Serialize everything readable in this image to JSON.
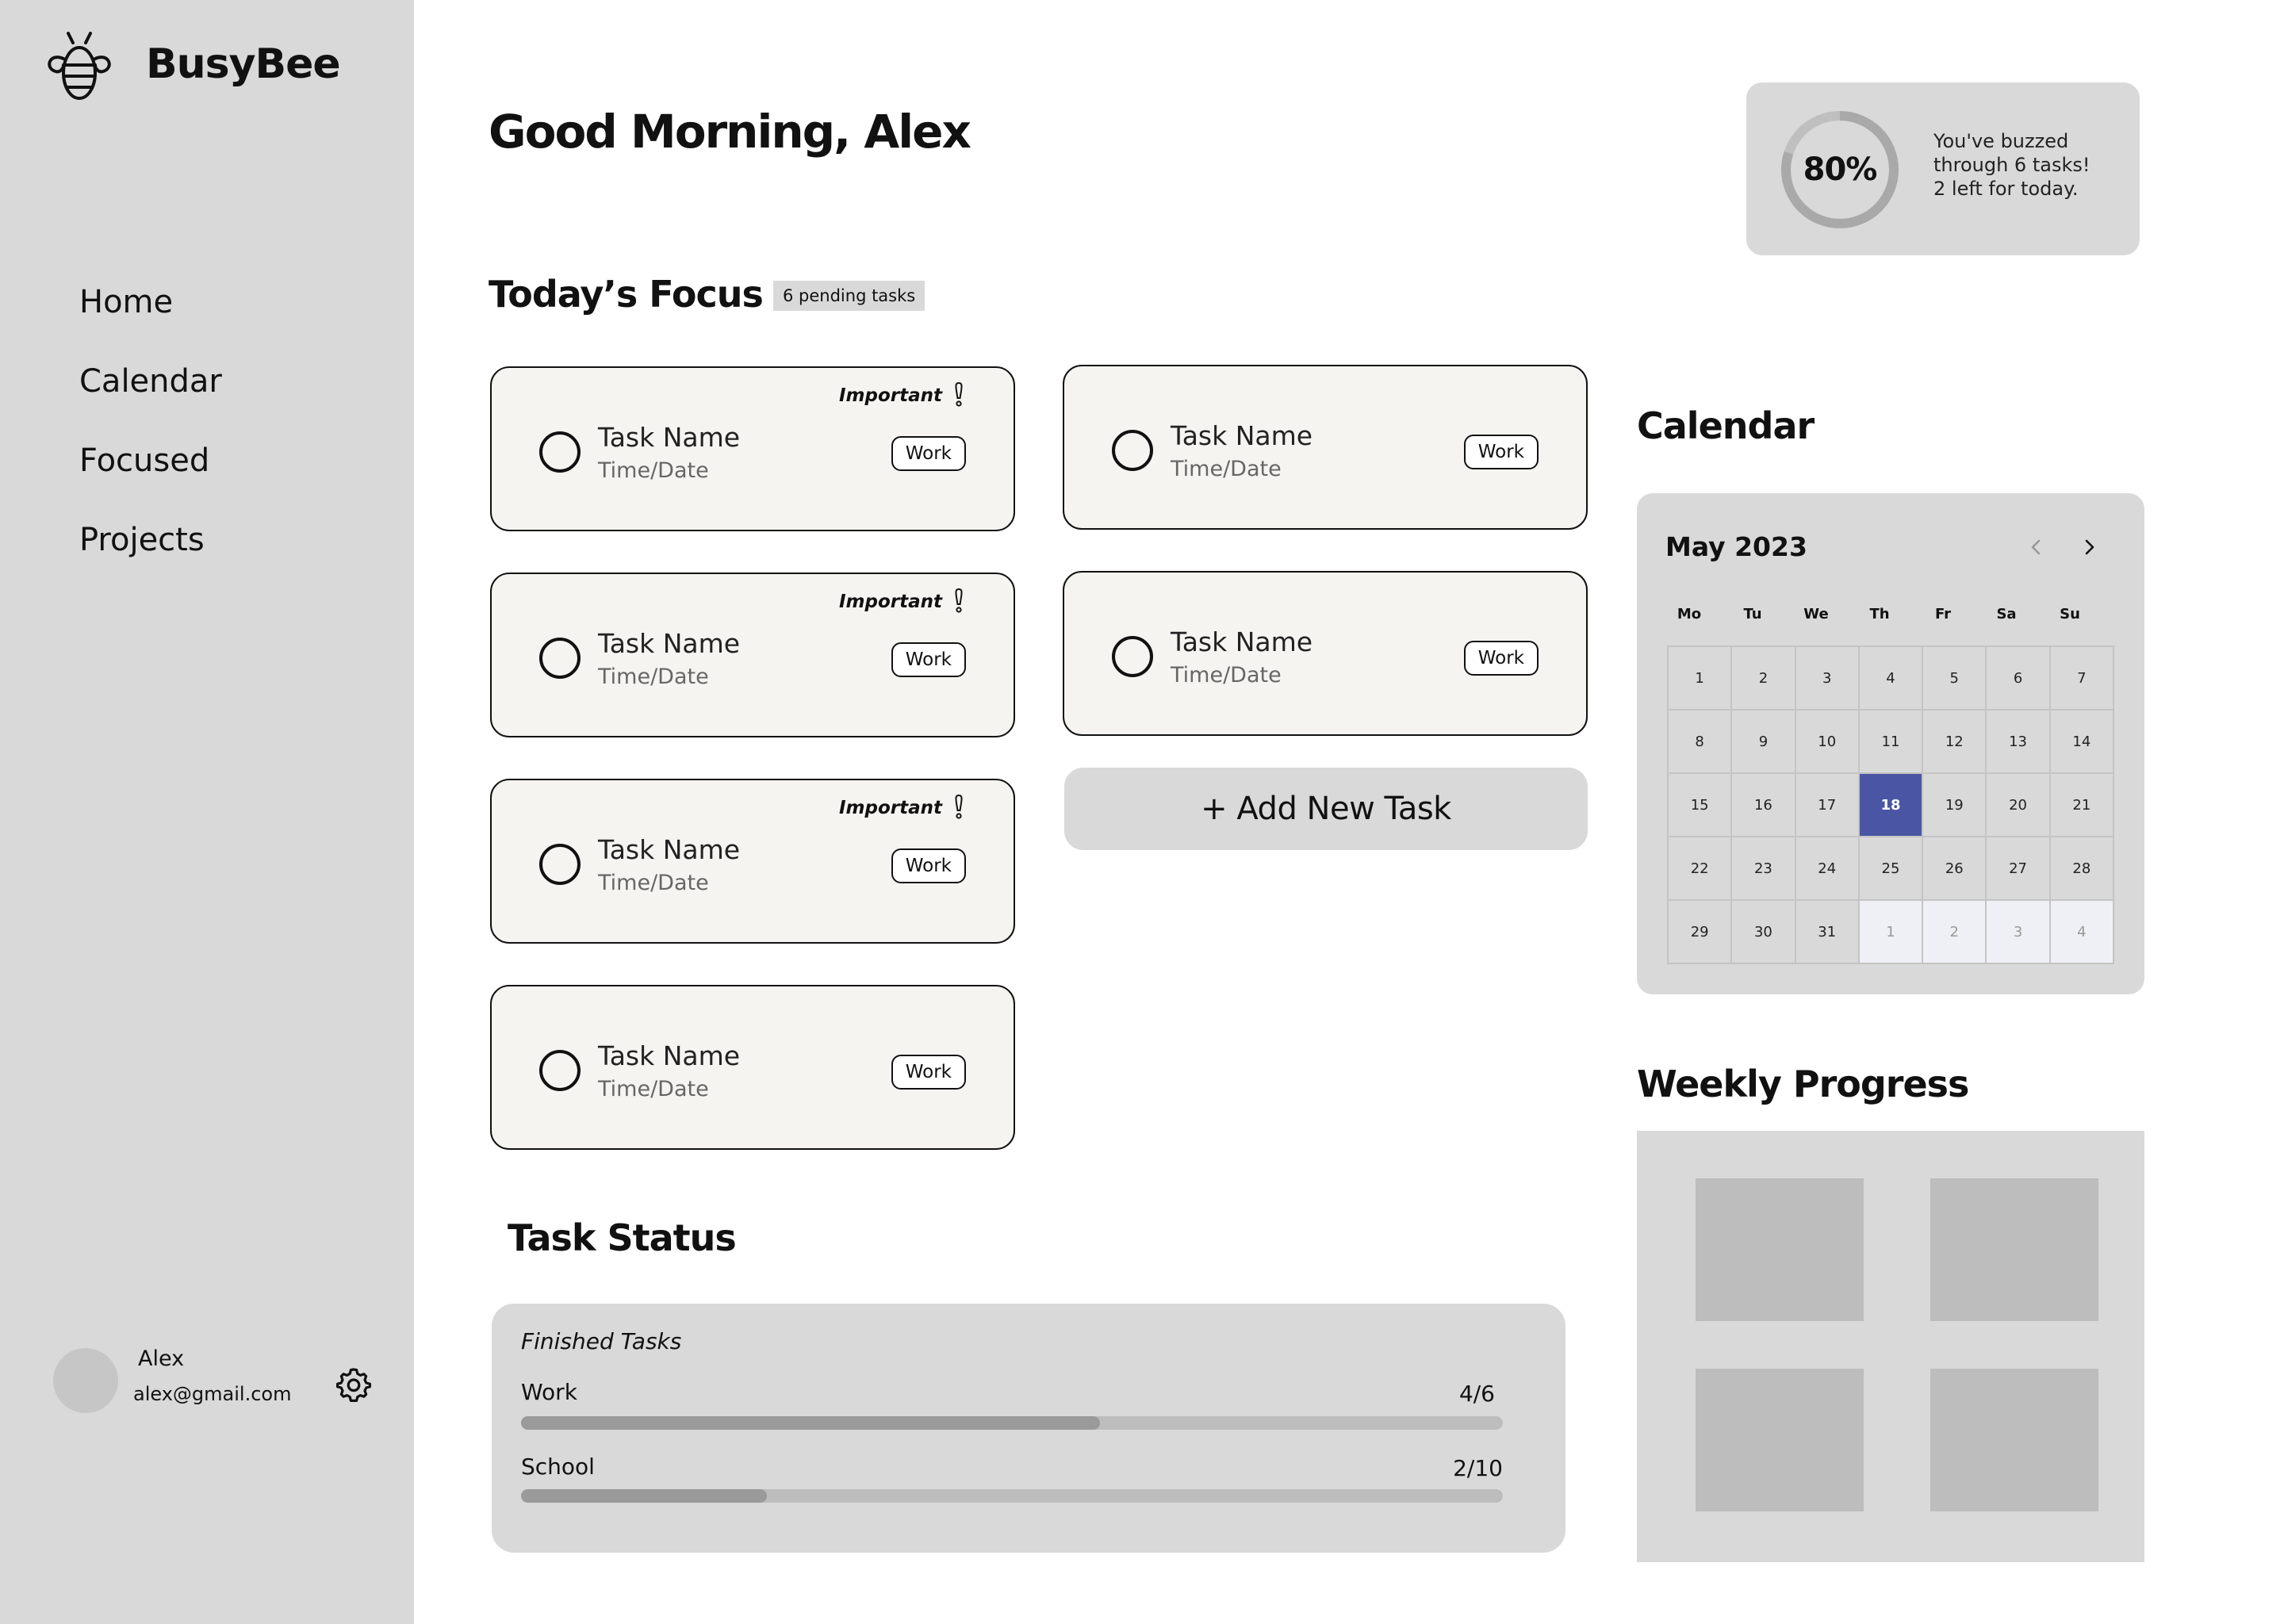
{
  "app": {
    "brand": "BusyBee"
  },
  "nav": [
    {
      "label": "Home"
    },
    {
      "label": "Calendar"
    },
    {
      "label": "Focused"
    },
    {
      "label": "Projects"
    }
  ],
  "user": {
    "name": "Alex",
    "email": "alex@gmail.com"
  },
  "header": {
    "greeting": "Good Morning, Alex"
  },
  "summary": {
    "percent_label": "80%",
    "percent_value": 0.8,
    "line1": "You've buzzed",
    "line2": "through 6 tasks!",
    "line3": "2 left for today."
  },
  "focus": {
    "title": "Today’s Focus",
    "badge": "6 pending tasks",
    "important_label": "Important",
    "tasks": [
      {
        "name": "Task Name",
        "time": "Time/Date",
        "tag": "Work",
        "important": true
      },
      {
        "name": "Task Name",
        "time": "Time/Date",
        "tag": "Work",
        "important": false
      },
      {
        "name": "Task Name",
        "time": "Time/Date",
        "tag": "Work",
        "important": true
      },
      {
        "name": "Task Name",
        "time": "Time/Date",
        "tag": "Work",
        "important": false
      },
      {
        "name": "Task Name",
        "time": "Time/Date",
        "tag": "Work",
        "important": true
      },
      {
        "name": "Task Name",
        "time": "Time/Date",
        "tag": "Work",
        "important": false
      }
    ],
    "add_label": "+ Add New Task"
  },
  "task_status": {
    "title": "Task Status",
    "heading": "Finished Tasks",
    "rows": [
      {
        "label": "Work",
        "count": "4/6",
        "progress": 0.59
      },
      {
        "label": "School",
        "count": "2/10",
        "progress": 0.25
      }
    ]
  },
  "calendar": {
    "title": "Calendar",
    "month": "May 2023",
    "weekdays": [
      "Mo",
      "Tu",
      "We",
      "Th",
      "Fr",
      "Sa",
      "Su"
    ],
    "days": [
      {
        "d": "1"
      },
      {
        "d": "2"
      },
      {
        "d": "3"
      },
      {
        "d": "4"
      },
      {
        "d": "5"
      },
      {
        "d": "6"
      },
      {
        "d": "7"
      },
      {
        "d": "8"
      },
      {
        "d": "9"
      },
      {
        "d": "10"
      },
      {
        "d": "11"
      },
      {
        "d": "12"
      },
      {
        "d": "13"
      },
      {
        "d": "14"
      },
      {
        "d": "15"
      },
      {
        "d": "16"
      },
      {
        "d": "17"
      },
      {
        "d": "18",
        "today": true
      },
      {
        "d": "19"
      },
      {
        "d": "20"
      },
      {
        "d": "21"
      },
      {
        "d": "22"
      },
      {
        "d": "23"
      },
      {
        "d": "24"
      },
      {
        "d": "25"
      },
      {
        "d": "26"
      },
      {
        "d": "27"
      },
      {
        "d": "28"
      },
      {
        "d": "29"
      },
      {
        "d": "30"
      },
      {
        "d": "31"
      },
      {
        "d": "1",
        "muted": true
      },
      {
        "d": "2",
        "muted": true
      },
      {
        "d": "3",
        "muted": true
      },
      {
        "d": "4",
        "muted": true
      }
    ],
    "accent": "#4a56a3"
  },
  "weekly": {
    "title": "Weekly Progress"
  },
  "icons": {
    "logo": "bee-icon",
    "settings": "gear-icon",
    "task_check": "circle-checkbox-icon",
    "important": "exclamation-icon",
    "prev": "chevron-left-icon",
    "next": "chevron-right-icon"
  }
}
